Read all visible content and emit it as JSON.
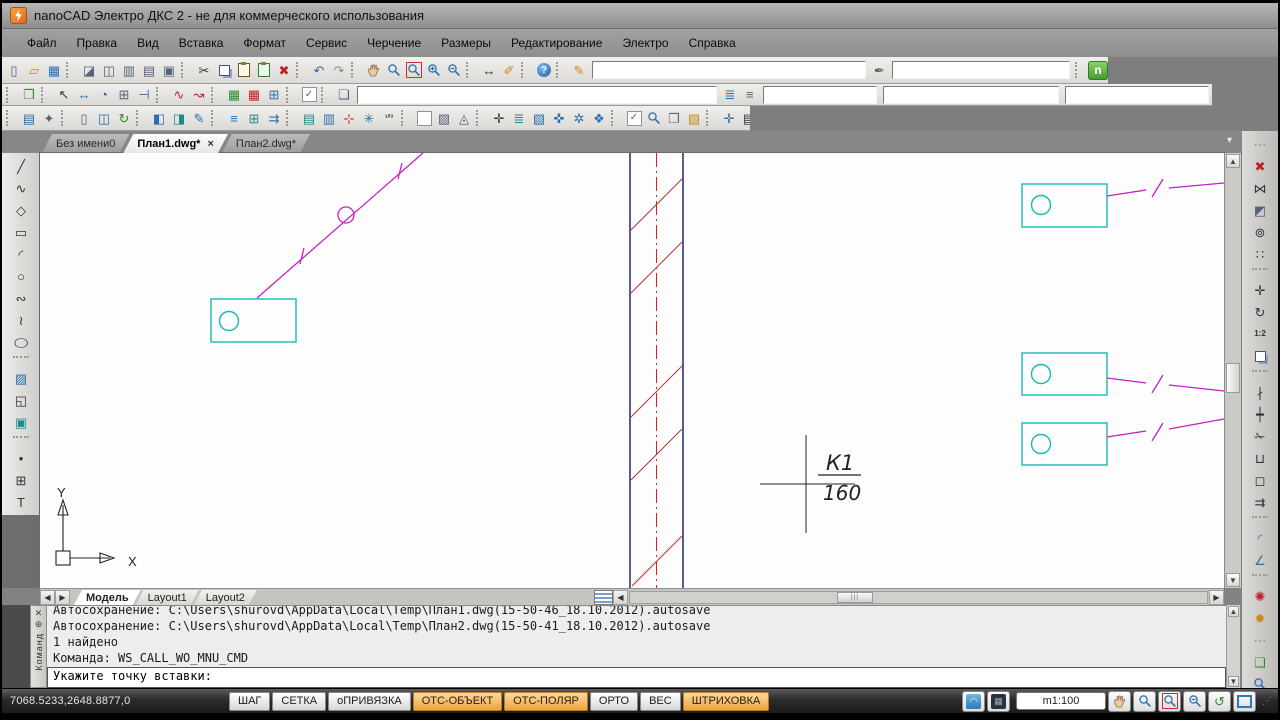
{
  "colors": {
    "accent_orange": "#f0a23c",
    "wire_magenta": "#c322c3",
    "fixture_cyan": "#17b8b8",
    "hatch_red": "#b43434",
    "wall_navy": "#17175c",
    "centerline_red": "#cc2424",
    "canvas_white": "#fdfdfd"
  },
  "title_bar": {
    "app_title": "nanoCAD Электро ДКС 2 - не для коммерческого использования"
  },
  "menu": {
    "items": [
      "Файл",
      "Правка",
      "Вид",
      "Вставка",
      "Формат",
      "Сервис",
      "Черчение",
      "Размеры",
      "Редактирование",
      "Электро",
      "Справка"
    ]
  },
  "toolbars": {
    "row1": [
      "new-file",
      "open-file",
      "save-file",
      "|",
      "plot-stamp",
      "print-preview",
      "plot-settings",
      "page-setup",
      "print",
      "|",
      "cut",
      "copy",
      "paste",
      "paste-block",
      "erase",
      "|",
      "undo",
      "redo",
      "|",
      "pan",
      "zoom-realtime",
      "zoom-window",
      "zoom-in",
      "zoom-out",
      "|",
      "measure-distance",
      "edit-length",
      "|",
      "help",
      "|"
    ],
    "row1_mid": [
      "script-edit"
    ],
    "row1_mid2": [
      "dim-style"
    ],
    "row1_end": [
      "|",
      "nanocad-logo"
    ],
    "row2": [
      "insert-object",
      "|",
      "select-pointer",
      "quick-select",
      "measure-angle",
      "grid-settings",
      "snap-offset",
      "|",
      "annotate-arc",
      "annotate-leader",
      "|",
      "xref-attach",
      "xref-edit",
      "table-edit",
      "|",
      "normcontrol",
      "|",
      "sheet-set"
    ],
    "row2b": [
      "layer-states",
      "layers"
    ],
    "row3": [
      "spec-db",
      "spec-settings",
      "|",
      "doc-page",
      "doc-structure",
      "doc-refresh",
      "|",
      "match-properties",
      "update-marks",
      "edit-marks",
      "|",
      "wire-lines",
      "wire-table",
      "wire-turn",
      "|",
      "equip-list",
      "equip-edit",
      "node-marker",
      "node-network",
      "numbering",
      "|",
      "room-blank",
      "room-hatch",
      "room-height",
      "|",
      "net-junction",
      "net-levels",
      "net-graph",
      "net-cross",
      "net-sockets",
      "net-diamond",
      "|",
      "check-net",
      "find-net",
      "net-pages",
      "net-paint",
      "|",
      "center-snap",
      "properties-list"
    ],
    "left": [
      "line",
      "polyline",
      "polygon",
      "rectangle",
      "arc",
      "circle",
      "revision-cloud",
      "spline",
      "ellipse",
      "|",
      "hatch",
      "region",
      "image",
      "|",
      "point",
      "table",
      "text"
    ],
    "right": [
      "grip",
      "erase",
      "mirror",
      "mirror-copy",
      "offset",
      "array",
      "|",
      "move",
      "rotate",
      "scale",
      "copy-object",
      "|",
      "break",
      "break-point",
      "trim",
      "join",
      "close-contour",
      "stretch",
      "|",
      "fillet",
      "chamfer",
      "|",
      "explode",
      "explode-text",
      "grip",
      "paste-up",
      "zoom-sel",
      "zoom-prev"
    ]
  },
  "doc_tabs": [
    {
      "label": "Без имени0",
      "active": false,
      "closable": false
    },
    {
      "label": "План1.dwg*",
      "active": true,
      "closable": true
    },
    {
      "label": "План2.dwg*",
      "active": false,
      "closable": false
    }
  ],
  "layout_tabs": [
    {
      "label": "Модель",
      "active": true
    },
    {
      "label": "Layout1",
      "active": false
    },
    {
      "label": "Layout2",
      "active": false
    }
  ],
  "drawing": {
    "k1_label": "К1",
    "k1_value": "160",
    "ucs_x": "X",
    "ucs_y": "Y"
  },
  "command": {
    "panel_label": "Команд",
    "history": [
      "Автосохранение: C:\\Users\\shurovd\\AppData\\Local\\Temp\\План1.dwg(15-50-46_18.10.2012).autosave",
      "Автосохранение: C:\\Users\\shurovd\\AppData\\Local\\Temp\\План2.dwg(15-50-41_18.10.2012).autosave",
      "1 найдено",
      "Команда: WS_CALL_WO_MNU_CMD"
    ],
    "prompt": "Укажите точку вставки:"
  },
  "status_bar": {
    "coords": "7068.5233,2648.8877,0",
    "toggles": [
      {
        "label": "ШАГ",
        "active": false
      },
      {
        "label": "СЕТКА",
        "active": false
      },
      {
        "label": "оПРИВЯЗКА",
        "active": false
      },
      {
        "label": "ОТС-ОБЪЕКТ",
        "active": true
      },
      {
        "label": "ОТС-ПОЛЯР",
        "active": true
      },
      {
        "label": "ОРТО",
        "active": false
      },
      {
        "label": "ВЕС",
        "active": false
      },
      {
        "label": "ШТРИХОВКА",
        "active": true
      }
    ],
    "scale": "m1:100",
    "icons_left": [
      "draft-display",
      "background-mode"
    ],
    "icons_right": [
      "pan",
      "zoom-realtime",
      "zoom-window",
      "zoom-out",
      "regen",
      "zoom-extents"
    ]
  }
}
